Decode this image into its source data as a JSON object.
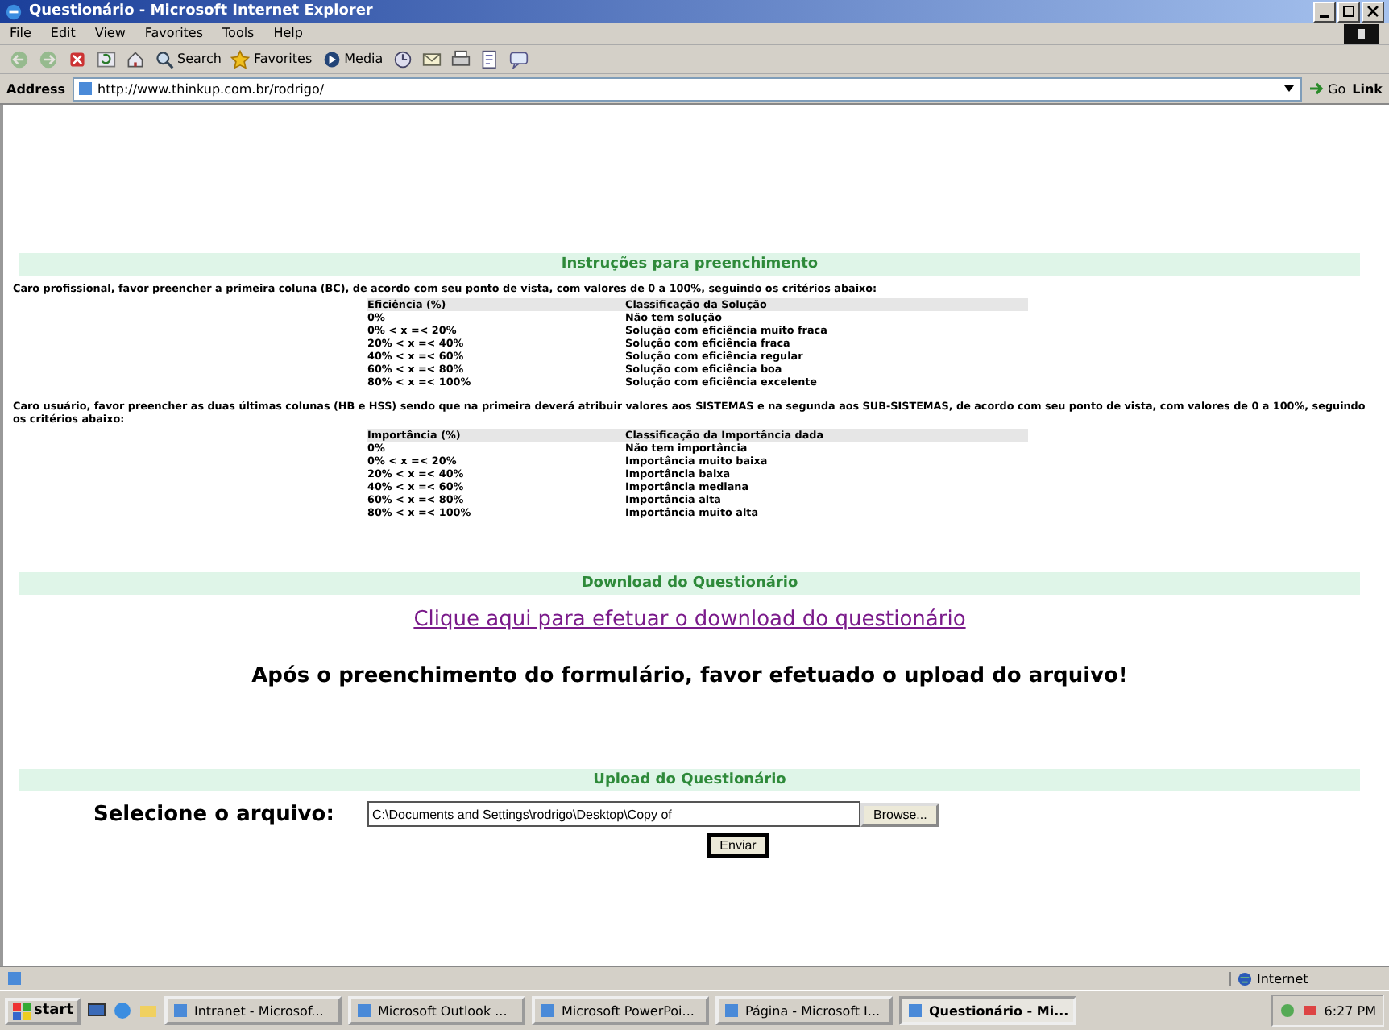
{
  "window": {
    "title": "Questionário - Microsoft Internet Explorer"
  },
  "menu": [
    "File",
    "Edit",
    "View",
    "Favorites",
    "Tools",
    "Help"
  ],
  "toolbar": [
    {
      "kind": "back",
      "disabled": true
    },
    {
      "kind": "forward",
      "disabled": true
    },
    {
      "kind": "stop",
      "disabled": false
    },
    {
      "kind": "refresh",
      "disabled": false
    },
    {
      "kind": "home",
      "disabled": false
    },
    {
      "kind": "search",
      "label": "Search",
      "disabled": false
    },
    {
      "kind": "favorites",
      "label": "Favorites",
      "disabled": false
    },
    {
      "kind": "media",
      "label": "Media",
      "disabled": false
    },
    {
      "kind": "history",
      "disabled": false
    },
    {
      "kind": "mail",
      "disabled": false
    },
    {
      "kind": "print",
      "disabled": false
    },
    {
      "kind": "edit",
      "disabled": false
    },
    {
      "kind": "discuss",
      "disabled": false
    }
  ],
  "address": {
    "label": "Address",
    "value": "http://www.thinkup.com.br/rodrigo/",
    "go": "Go",
    "links": "Link"
  },
  "instructions": {
    "heading": "Instruções para preenchimento",
    "intro_1": "Caro profissional, favor preencher a primeira coluna (BC), de acordo com seu ponto de vista, com valores de 0 a 100%, seguindo os critérios abaixo:",
    "table_1": {
      "columns": [
        "Eficiência (%)",
        "Classificação da Solução"
      ],
      "rows": [
        [
          "0%",
          "Não tem solução"
        ],
        [
          "0% < x =< 20%",
          "Solução com eficiência muito fraca"
        ],
        [
          "20% < x =< 40%",
          "Solução com eficiência fraca"
        ],
        [
          "40% < x =< 60%",
          "Solução com eficiência regular"
        ],
        [
          "60% < x =< 80%",
          "Solução com eficiência boa"
        ],
        [
          "80% < x =< 100%",
          "Solução com eficiência excelente"
        ]
      ]
    },
    "intro_2": "Caro usuário, favor preencher as duas últimas colunas (HB e HSS) sendo que na primeira deverá atribuir valores aos SISTEMAS e na segunda aos SUB-SISTEMAS, de acordo com seu ponto de vista, com valores de 0 a 100%, seguindo os critérios abaixo:",
    "table_2": {
      "columns": [
        "Importância (%)",
        "Classificação da Importância dada"
      ],
      "rows": [
        [
          "0%",
          "Não tem importância"
        ],
        [
          "0% < x =< 20%",
          "Importância muito baixa"
        ],
        [
          "20% < x =< 40%",
          "Importância baixa"
        ],
        [
          "40% < x =< 60%",
          "Importância mediana"
        ],
        [
          "60% < x =< 80%",
          "Importância alta"
        ],
        [
          "80% < x =< 100%",
          "Importância muito alta"
        ]
      ]
    }
  },
  "download": {
    "heading": "Download do Questionário",
    "link": "Clique aqui para efetuar o download do questionário",
    "notice": "Após o preenchimento do formulário, favor efetuado o upload do arquivo!"
  },
  "upload": {
    "heading": "Upload do Questionário",
    "label": "Selecione o arquivo:",
    "file_value": "C:\\Documents and Settings\\rodrigo\\Desktop\\Copy of",
    "browse": "Browse...",
    "submit": "Enviar"
  },
  "status_bar": {
    "zone": "Internet"
  },
  "taskbar": {
    "start": "start",
    "items": [
      {
        "label": "Intranet - Microsof...",
        "selected": false
      },
      {
        "label": "Microsoft Outlook ...",
        "selected": false
      },
      {
        "label": "Microsoft PowerPoi...",
        "selected": false
      },
      {
        "label": "Página - Microsoft I...",
        "selected": false
      },
      {
        "label": "Questionário - Mi...",
        "selected": true
      }
    ],
    "clock": "6:27 PM"
  }
}
